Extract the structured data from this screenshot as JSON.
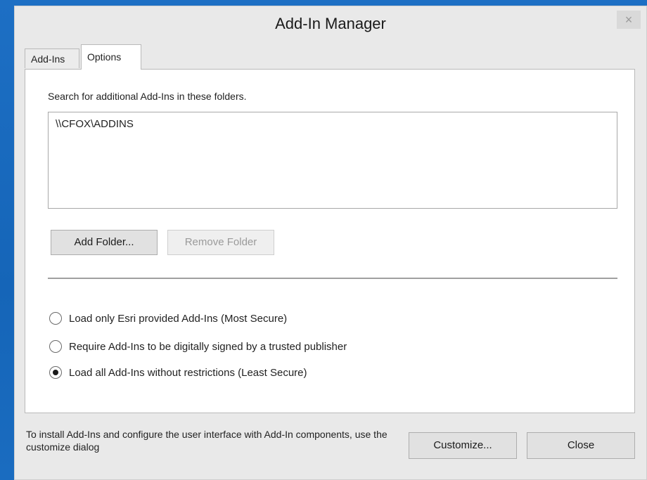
{
  "window": {
    "title": "Add-In Manager",
    "close_label": "×"
  },
  "tabs": [
    {
      "label": "Add-Ins"
    },
    {
      "label": "Options",
      "selected": true
    }
  ],
  "options": {
    "search_label": "Search for additional Add-Ins in these folders.",
    "folders": [
      "\\\\CFOX\\ADDINS"
    ],
    "add_folder_label": "Add Folder...",
    "remove_folder_label": "Remove Folder"
  },
  "security": {
    "options": [
      {
        "label": "Load only Esri provided Add-Ins (Most Secure)",
        "checked": false
      },
      {
        "label": "Require Add-Ins to be digitally signed by a trusted publisher",
        "checked": false
      },
      {
        "label": "Load all Add-Ins without restrictions (Least Secure)",
        "checked": true
      }
    ]
  },
  "footer": {
    "text": "To install Add-Ins and configure the user interface with Add-In components, use the customize dialog",
    "customize_label": "Customize...",
    "close_label": "Close"
  },
  "colors": {
    "desktop": "#1565b8",
    "dialog": "#e9e9e9",
    "panel": "#ffffff"
  }
}
